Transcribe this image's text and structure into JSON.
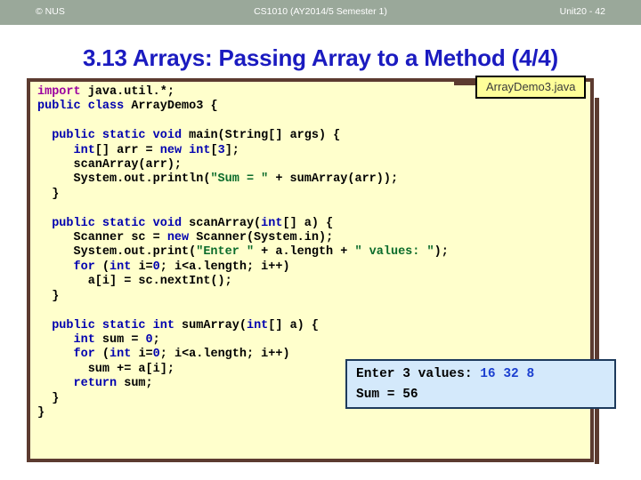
{
  "header": {
    "left": "© NUS",
    "center": "CS1010 (AY2014/5 Semester 1)",
    "right": "Unit20 - 42"
  },
  "title": "3.13 Arrays: Passing Array to a Method (4/4)",
  "file_label": "ArrayDemo3.java",
  "code": {
    "language": "java",
    "lines": [
      "import java.util.*;",
      "public class ArrayDemo3 {",
      "",
      "  public static void main(String[] args) {",
      "     int[] arr = new int[3];",
      "     scanArray(arr);",
      "     System.out.println(\"Sum = \" + sumArray(arr));",
      "  }",
      "",
      "  public static void scanArray(int[] a) {",
      "     Scanner sc = new Scanner(System.in);",
      "     System.out.print(\"Enter \" + a.length + \" values: \");",
      "     for (int i=0; i<a.length; i++)",
      "       a[i] = sc.nextInt();",
      "  }",
      "",
      "  public static int sumArray(int[] a) {",
      "     int sum = 0;",
      "     for (int i=0; i<a.length; i++)",
      "       sum += a[i];",
      "     return sum;",
      "  }",
      "}"
    ]
  },
  "console": {
    "line1_prompt": "Enter 3 values: ",
    "line1_input": "16 32 8",
    "line2": "Sum = 56"
  },
  "colors": {
    "header_bg": "#9aa89a",
    "title": "#1b1bc0",
    "code_bg": "#ffffcc",
    "code_border": "#5c3b30",
    "label_bg": "#ffff99",
    "console_bg": "#d4e9fb",
    "console_border": "#1d3a5c",
    "keyword": "#0000b0",
    "import_keyword": "#9b00a0",
    "string": "#0a6b2a",
    "user_input": "#1b3fd0"
  }
}
